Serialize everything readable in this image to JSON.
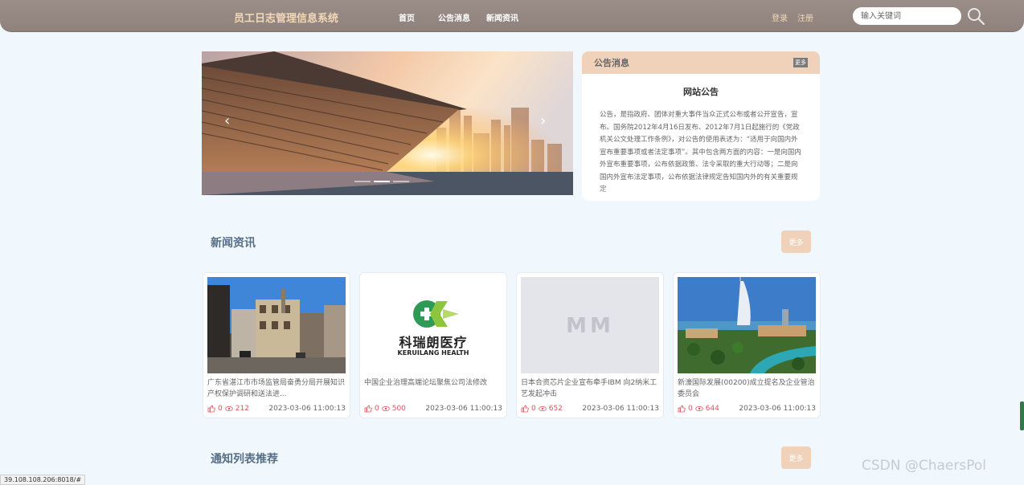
{
  "header": {
    "brand": "员工日志管理信息系统",
    "nav": [
      {
        "label": "首页"
      },
      {
        "label": "公告消息"
      },
      {
        "label": "新闻资讯"
      }
    ],
    "login": "登录",
    "register": "注册",
    "search": {
      "placeholder": "输入关键词",
      "value": ""
    },
    "search_icon": "search-icon"
  },
  "banner": {
    "prev_icon": "chevron-left-icon",
    "next_icon": "chevron-right-icon",
    "slides": 3,
    "active_slide": 1
  },
  "notice": {
    "heading": "公告消息",
    "more": "更多",
    "title": "网站公告",
    "body": "公告，是指政府、团体对重大事件当众正式公布或者公开宣告，宣布。国务院2012年4月16日发布、2012年7月1日起施行的《党政机关公文处理工作条例》，对公告的使用表述为：“适用于向国内外宣布重要事项或者法定事项”。其中包含两方面的内容：一是向国内外宣布重要事项，公布依据政策、法令采取的重大行动等；二是向国内外宣布法定事项，公布依据法律规定告知国内外的有关重要规定"
  },
  "news": {
    "heading": "新闻资讯",
    "more": "更多",
    "items": [
      {
        "title": "广东省湛江市市场监管局奋勇分局开展知识产权保护调研和送法进...",
        "likes": "0",
        "views": "212",
        "date": "2023-03-06 11:00:13",
        "image": "building-photo"
      },
      {
        "title": "中国企业治理高端论坛聚焦公司法修改",
        "likes": "0",
        "views": "500",
        "date": "2023-03-06 11:00:13",
        "image": "keruilang-logo",
        "logo_cn": "科瑞朗医疗",
        "logo_en": "KERUILANG HEALTH"
      },
      {
        "title": "日本合资芯片企业宣布牵手IBM 向2纳米工艺发起冲击",
        "likes": "0",
        "views": "652",
        "date": "2023-03-06 11:00:13",
        "image": "placeholder",
        "placeholder_text": "MM"
      },
      {
        "title": "新濠国际发展(00200)成立提名及企业管治委员会",
        "likes": "0",
        "views": "644",
        "date": "2023-03-06 11:00:13",
        "image": "resort-photo"
      }
    ]
  },
  "recommend": {
    "heading": "通知列表推荐",
    "more": "更多"
  },
  "status_url": "39.108.108.206:8018/#",
  "watermark": "CSDN @ChaersPol",
  "colors": {
    "header_bg": "#938680",
    "brand": "#f2d8b6",
    "accent": "#f0d2ba",
    "section_title": "#566f86",
    "count_red": "#e4525d",
    "page_bg": "#f0f7fd"
  }
}
